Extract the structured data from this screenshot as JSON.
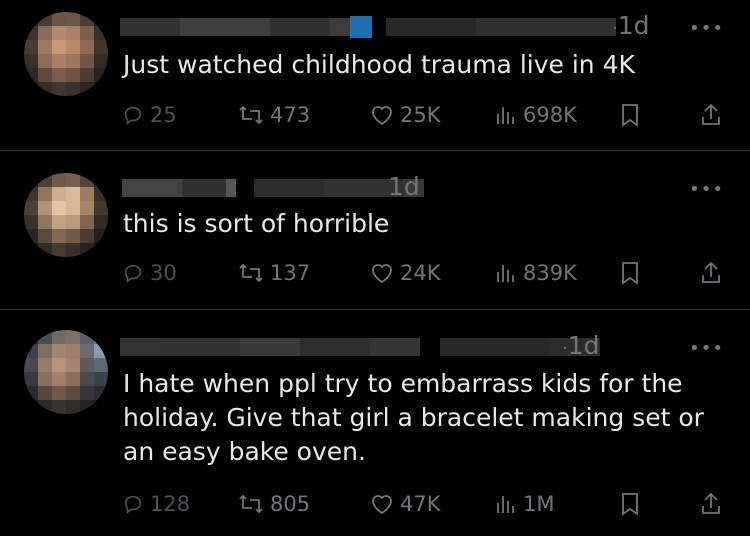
{
  "tweets": [
    {
      "time": "1d",
      "time_prefix": "·",
      "text": "Just watched childhood trauma live in 4K",
      "replies": "25",
      "reposts": "473",
      "likes": "25K",
      "views": "698K"
    },
    {
      "time": "1d",
      "time_prefix": "",
      "text": "this is sort of horrible",
      "replies": "30",
      "reposts": "137",
      "likes": "24K",
      "views": "839K"
    },
    {
      "time": "1d",
      "time_prefix": "·",
      "text": "I hate when ppl try to embarrass kids for the holiday. Give that girl a bracelet making set or an easy bake oven.",
      "replies": "128",
      "reposts": "805",
      "likes": "47K",
      "views": "1M"
    }
  ],
  "icons": {
    "more": "more-horizontal-icon",
    "reply": "reply-icon",
    "repost": "repost-icon",
    "like": "heart-icon",
    "views": "views-icon",
    "bookmark": "bookmark-icon",
    "share": "share-icon"
  },
  "more_glyph": "•••",
  "colors": {
    "background": "#000000",
    "text": "#e7e9ea",
    "secondary": "#71767b",
    "divider": "#2f3336",
    "verified_blue": "#1d9bf0"
  }
}
